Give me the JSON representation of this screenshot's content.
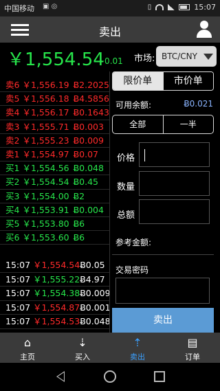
{
  "status_bar": {
    "carrier": "中国移动",
    "time": "15:07"
  },
  "header": {
    "title": "卖出"
  },
  "ticker": {
    "price": "￥1,554.54",
    "change": "+0.01",
    "market_label": "市场:",
    "market_value": "BTC/CNY"
  },
  "order_book": {
    "asks": [
      {
        "label": "卖6",
        "price": "￥1,556.19",
        "amount": "Ƀ2.2025"
      },
      {
        "label": "卖5",
        "price": "￥1,556.18",
        "amount": "Ƀ4.5856"
      },
      {
        "label": "卖4",
        "price": "￥1,556.17",
        "amount": "Ƀ0.1643"
      },
      {
        "label": "卖3",
        "price": "￥1,555.71",
        "amount": "Ƀ0.003"
      },
      {
        "label": "卖2",
        "price": "￥1,555.23",
        "amount": "Ƀ0.009"
      },
      {
        "label": "卖1",
        "price": "￥1,554.97",
        "amount": "Ƀ0.07"
      }
    ],
    "bids": [
      {
        "label": "买1",
        "price": "￥1,554.56",
        "amount": "Ƀ0.048"
      },
      {
        "label": "买2",
        "price": "￥1,554.54",
        "amount": "Ƀ0.45"
      },
      {
        "label": "买3",
        "price": "￥1,554.00",
        "amount": "Ƀ2"
      },
      {
        "label": "买4",
        "price": "￥1,553.91",
        "amount": "Ƀ0.004"
      },
      {
        "label": "买5",
        "price": "￥1,553.80",
        "amount": "Ƀ6"
      },
      {
        "label": "买6",
        "price": "￥1,553.60",
        "amount": "Ƀ6"
      }
    ]
  },
  "trades": [
    {
      "time": "15:07",
      "price": "￥1,554.54",
      "amount": "Ƀ0.05",
      "side": "sell"
    },
    {
      "time": "15:07",
      "price": "￥1,555.22",
      "amount": "Ƀ4.97",
      "side": "buy"
    },
    {
      "time": "15:07",
      "price": "￥1,554.38",
      "amount": "Ƀ0.009",
      "side": "buy"
    },
    {
      "time": "15:07",
      "price": "￥1,554.87",
      "amount": "Ƀ0.001",
      "side": "sell"
    },
    {
      "time": "15:07",
      "price": "￥1,554.53",
      "amount": "Ƀ0.048",
      "side": "sell"
    }
  ],
  "order_form": {
    "tab_limit": "限价单",
    "tab_market": "市价单",
    "balance_label": "可用余额:",
    "balance_value": "Ƀ0.021",
    "btn_all": "全部",
    "btn_half": "一半",
    "price_label": "价格",
    "quantity_label": "数量",
    "total_label": "总额",
    "ref_amount_label": "参考金额:",
    "password_label": "交易密码",
    "submit_label": "卖出"
  },
  "bottom_nav": [
    {
      "label": "主页",
      "icon": "home-icon"
    },
    {
      "label": "买入",
      "icon": "buy-icon"
    },
    {
      "label": "卖出",
      "icon": "sell-icon",
      "active": true
    },
    {
      "label": "订单",
      "icon": "order-icon"
    }
  ],
  "colors": {
    "ask": "#ff2a2a",
    "bid": "#27e64b",
    "accent": "#3aa0ff",
    "submit": "#5b9bd5"
  }
}
